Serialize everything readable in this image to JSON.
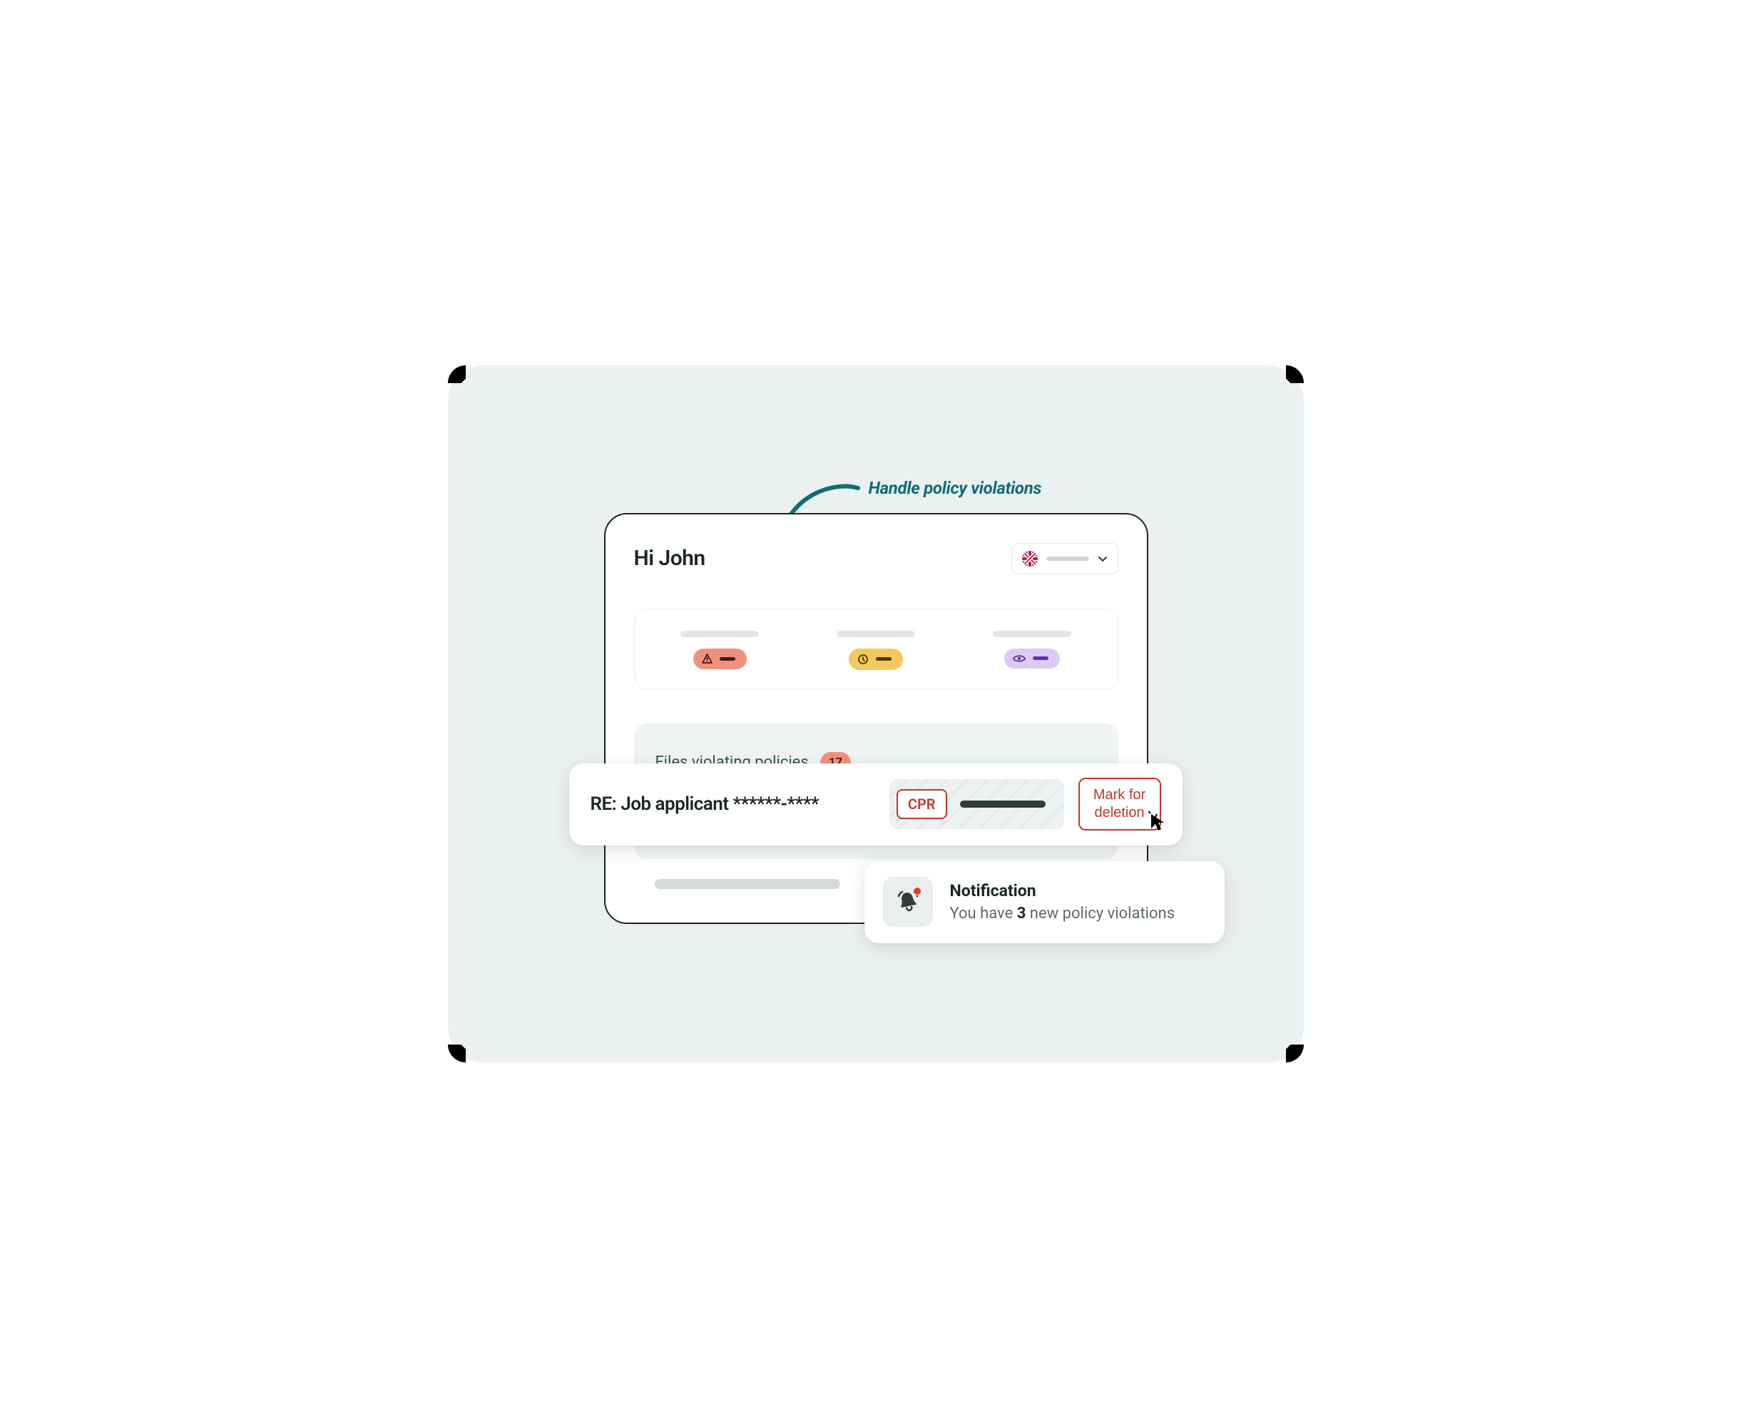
{
  "annotation": "Handle policy violations",
  "header": {
    "greeting": "Hi John",
    "language": "en-GB"
  },
  "stats": [
    {
      "kind": "alert",
      "color": "red"
    },
    {
      "kind": "clock",
      "color": "yellow"
    },
    {
      "kind": "eye",
      "color": "purple"
    }
  ],
  "panel": {
    "title": "Files violating policies",
    "count": 17
  },
  "file_row": {
    "title": "RE: Job applicant ******-****",
    "tag": "CPR",
    "action": "Mark for deletion"
  },
  "notification": {
    "title": "Notification",
    "message_pre": "You have ",
    "count": 3,
    "message_post": " new policy violations"
  },
  "colors": {
    "teal": "#0f6e74",
    "danger": "#c0382e",
    "pill_red": "#f0917d",
    "pill_yellow": "#f3c95e",
    "pill_purple": "#dccbf5"
  }
}
